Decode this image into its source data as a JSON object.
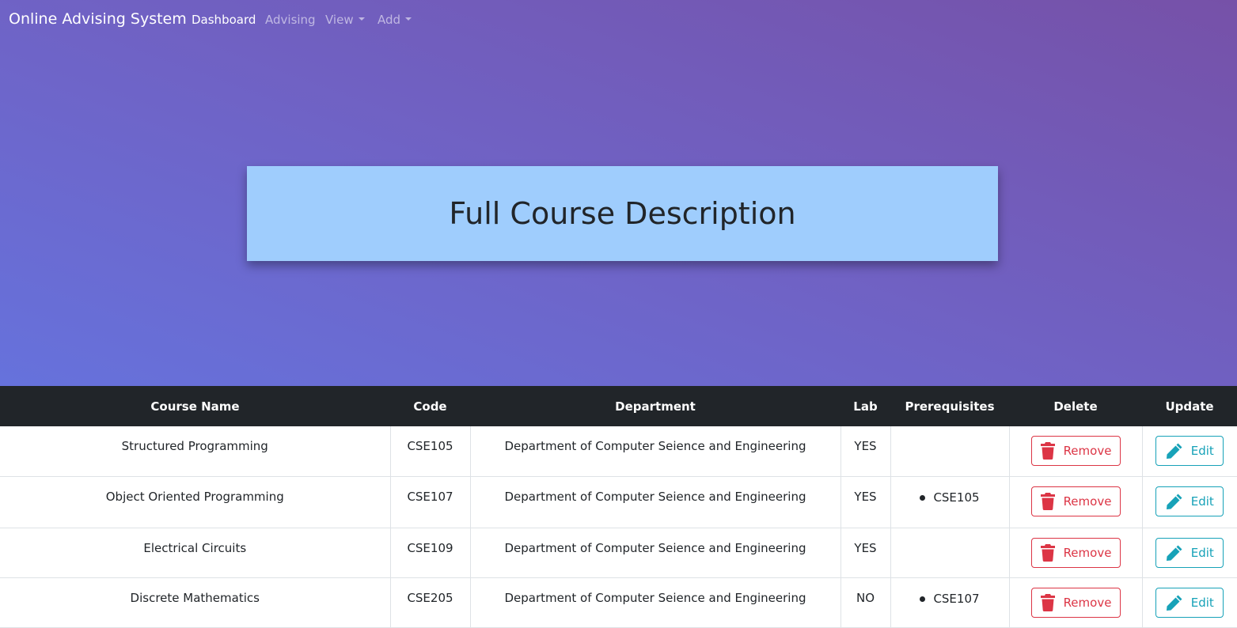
{
  "navbar": {
    "brand": "Online Advising System",
    "links": [
      {
        "label": "Dashboard"
      },
      {
        "label": "Advising"
      },
      {
        "label": "View"
      },
      {
        "label": "Add"
      }
    ]
  },
  "page": {
    "title": "Full Course Description"
  },
  "table": {
    "headers": {
      "course_name": "Course Name",
      "code": "Code",
      "department": "Department",
      "lab": "Lab",
      "prerequisites": "Prerequisites",
      "delete": "Delete",
      "update": "Update"
    },
    "rows": [
      {
        "course_name": "Structured Programming",
        "code": "CSE105",
        "department": "Department of Computer Seience and Engineering",
        "lab": "YES",
        "prerequisite": ""
      },
      {
        "course_name": "Object Oriented Programming",
        "code": "CSE107",
        "department": "Department of Computer Seience and Engineering",
        "lab": "YES",
        "prerequisite": "CSE105"
      },
      {
        "course_name": "Electrical Circuits",
        "code": "CSE109",
        "department": "Department of Computer Seience and Engineering",
        "lab": "YES",
        "prerequisite": ""
      },
      {
        "course_name": "Discrete Mathematics",
        "code": "CSE205",
        "department": "Department of Computer Seience and Engineering",
        "lab": "NO",
        "prerequisite": "CSE107"
      }
    ],
    "remove_label": "Remove",
    "edit_label": "Edit"
  },
  "colors": {
    "danger": "#dc3545",
    "info": "#17a2b8",
    "header_bg": "#212529",
    "title_box": "#9fcdfd"
  }
}
